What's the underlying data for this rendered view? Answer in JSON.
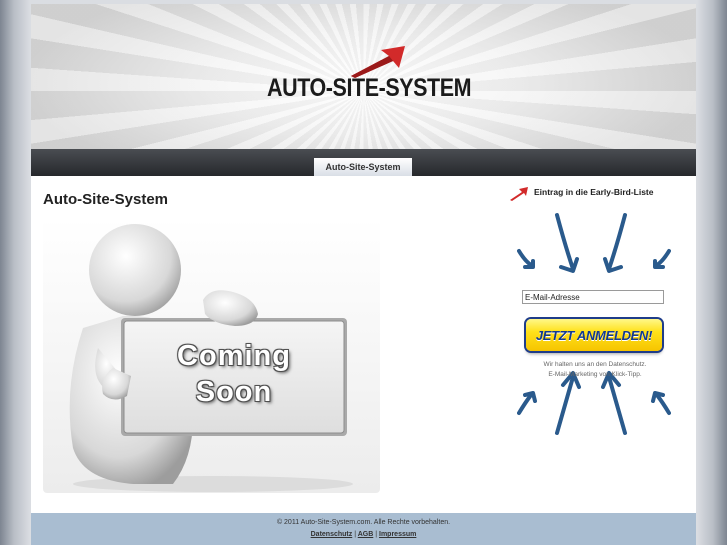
{
  "header": {
    "logo_text": "AUTO-SITE-SYSTEM"
  },
  "nav": {
    "tabs": [
      {
        "label": "Auto-Site-System"
      }
    ]
  },
  "main": {
    "title": "Auto-Site-System",
    "coming_soon": {
      "line1": "Coming",
      "line2": "Soon"
    }
  },
  "sidebar": {
    "title": "Eintrag in die Early-Bird-Liste",
    "email_placeholder": "E-Mail-Adresse",
    "signup_label": "JETZT ANMELDEN!",
    "privacy_line1": "Wir halten uns an den Datenschutz.",
    "privacy_line2": "E-Mail-Marketing von Klick-Tipp."
  },
  "footer": {
    "copyright": "© 2011 Auto-Site-System.com. Alle Rechte vorbehalten.",
    "links": [
      {
        "label": "Datenschutz"
      },
      {
        "label": "AGB"
      },
      {
        "label": "Impressum"
      }
    ],
    "separator": "|"
  },
  "colors": {
    "accent_red": "#d22a2a",
    "arrow_blue": "#2a5a8c",
    "button_yellow": "#ffe11a",
    "button_text": "#123a8f",
    "footer_bg": "#a9bdd1",
    "nav_bg": "#2e3034"
  }
}
